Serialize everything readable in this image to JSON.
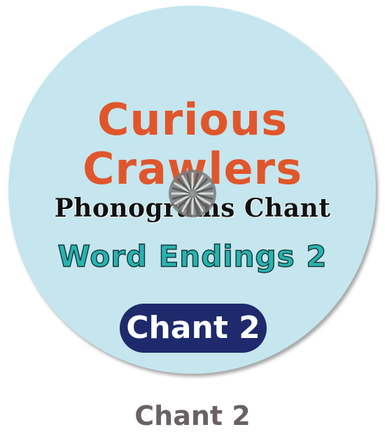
{
  "disc": {
    "title_line1": "Curious",
    "title_line2": "Crawlers",
    "subtitle": "Phonograms Chant",
    "topic": "Word Endings 2",
    "badge": "Chant 2"
  },
  "caption": "Chant 2",
  "icons": {
    "loading": "loading-spinner-icon"
  },
  "colors": {
    "disc_background": "#c5e6ee",
    "title": "#e0562b",
    "topic": "#27b3b1",
    "badge_background": "#1e2a6b",
    "caption": "#6a6262"
  }
}
